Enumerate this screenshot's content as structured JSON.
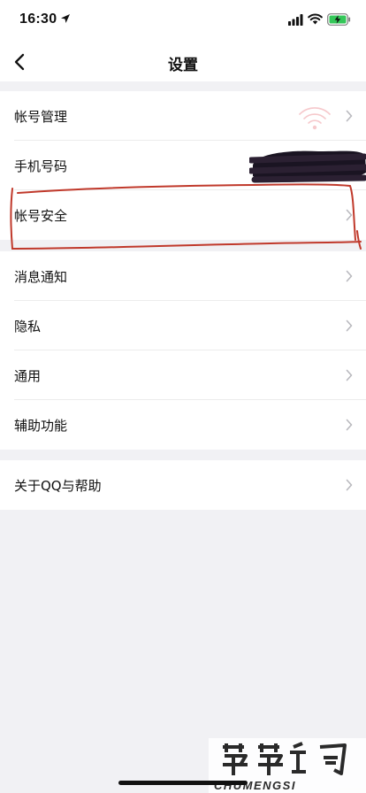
{
  "status_bar": {
    "time": "16:30"
  },
  "nav": {
    "title": "设置"
  },
  "groups": [
    {
      "items": [
        {
          "label": "帐号管理"
        },
        {
          "label": "手机号码"
        },
        {
          "label": "帐号安全"
        }
      ]
    },
    {
      "items": [
        {
          "label": "消息通知"
        },
        {
          "label": "隐私"
        },
        {
          "label": "通用"
        },
        {
          "label": "辅助功能"
        }
      ]
    },
    {
      "items": [
        {
          "label": "关于QQ与帮助"
        }
      ]
    }
  ],
  "watermark": {
    "text": "CHUMENGSI"
  },
  "colors": {
    "annotation": "#c0392b",
    "chevron": "#b9b9be",
    "background": "#f1f1f4"
  }
}
